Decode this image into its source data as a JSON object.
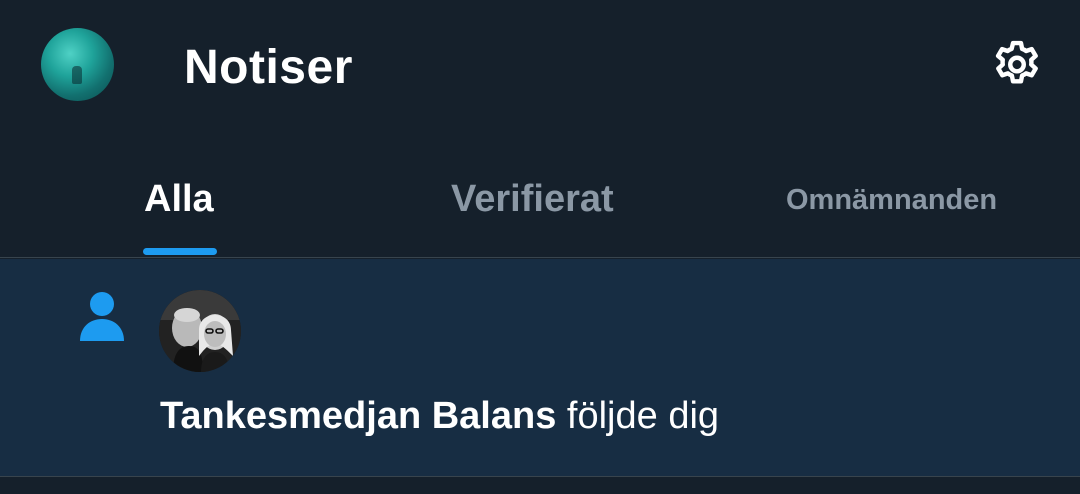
{
  "header": {
    "title": "Notiser",
    "profile_avatar_icon": "profile-avatar",
    "settings_icon": "gear-icon"
  },
  "tabs": [
    {
      "label": "Alla",
      "active": true
    },
    {
      "label": "Verifierat",
      "active": false
    },
    {
      "label": "Omnämnanden",
      "active": false
    }
  ],
  "notifications": [
    {
      "type": "follow",
      "icon": "person-icon",
      "user_name": "Tankesmedjan Balans",
      "action_text": "följde dig"
    }
  ],
  "colors": {
    "background": "#15202b",
    "notification_unread_bg": "#172d43",
    "accent": "#1d9bf0",
    "text_primary": "#ffffff",
    "text_secondary": "#8b98a5",
    "divider": "#38444d"
  }
}
